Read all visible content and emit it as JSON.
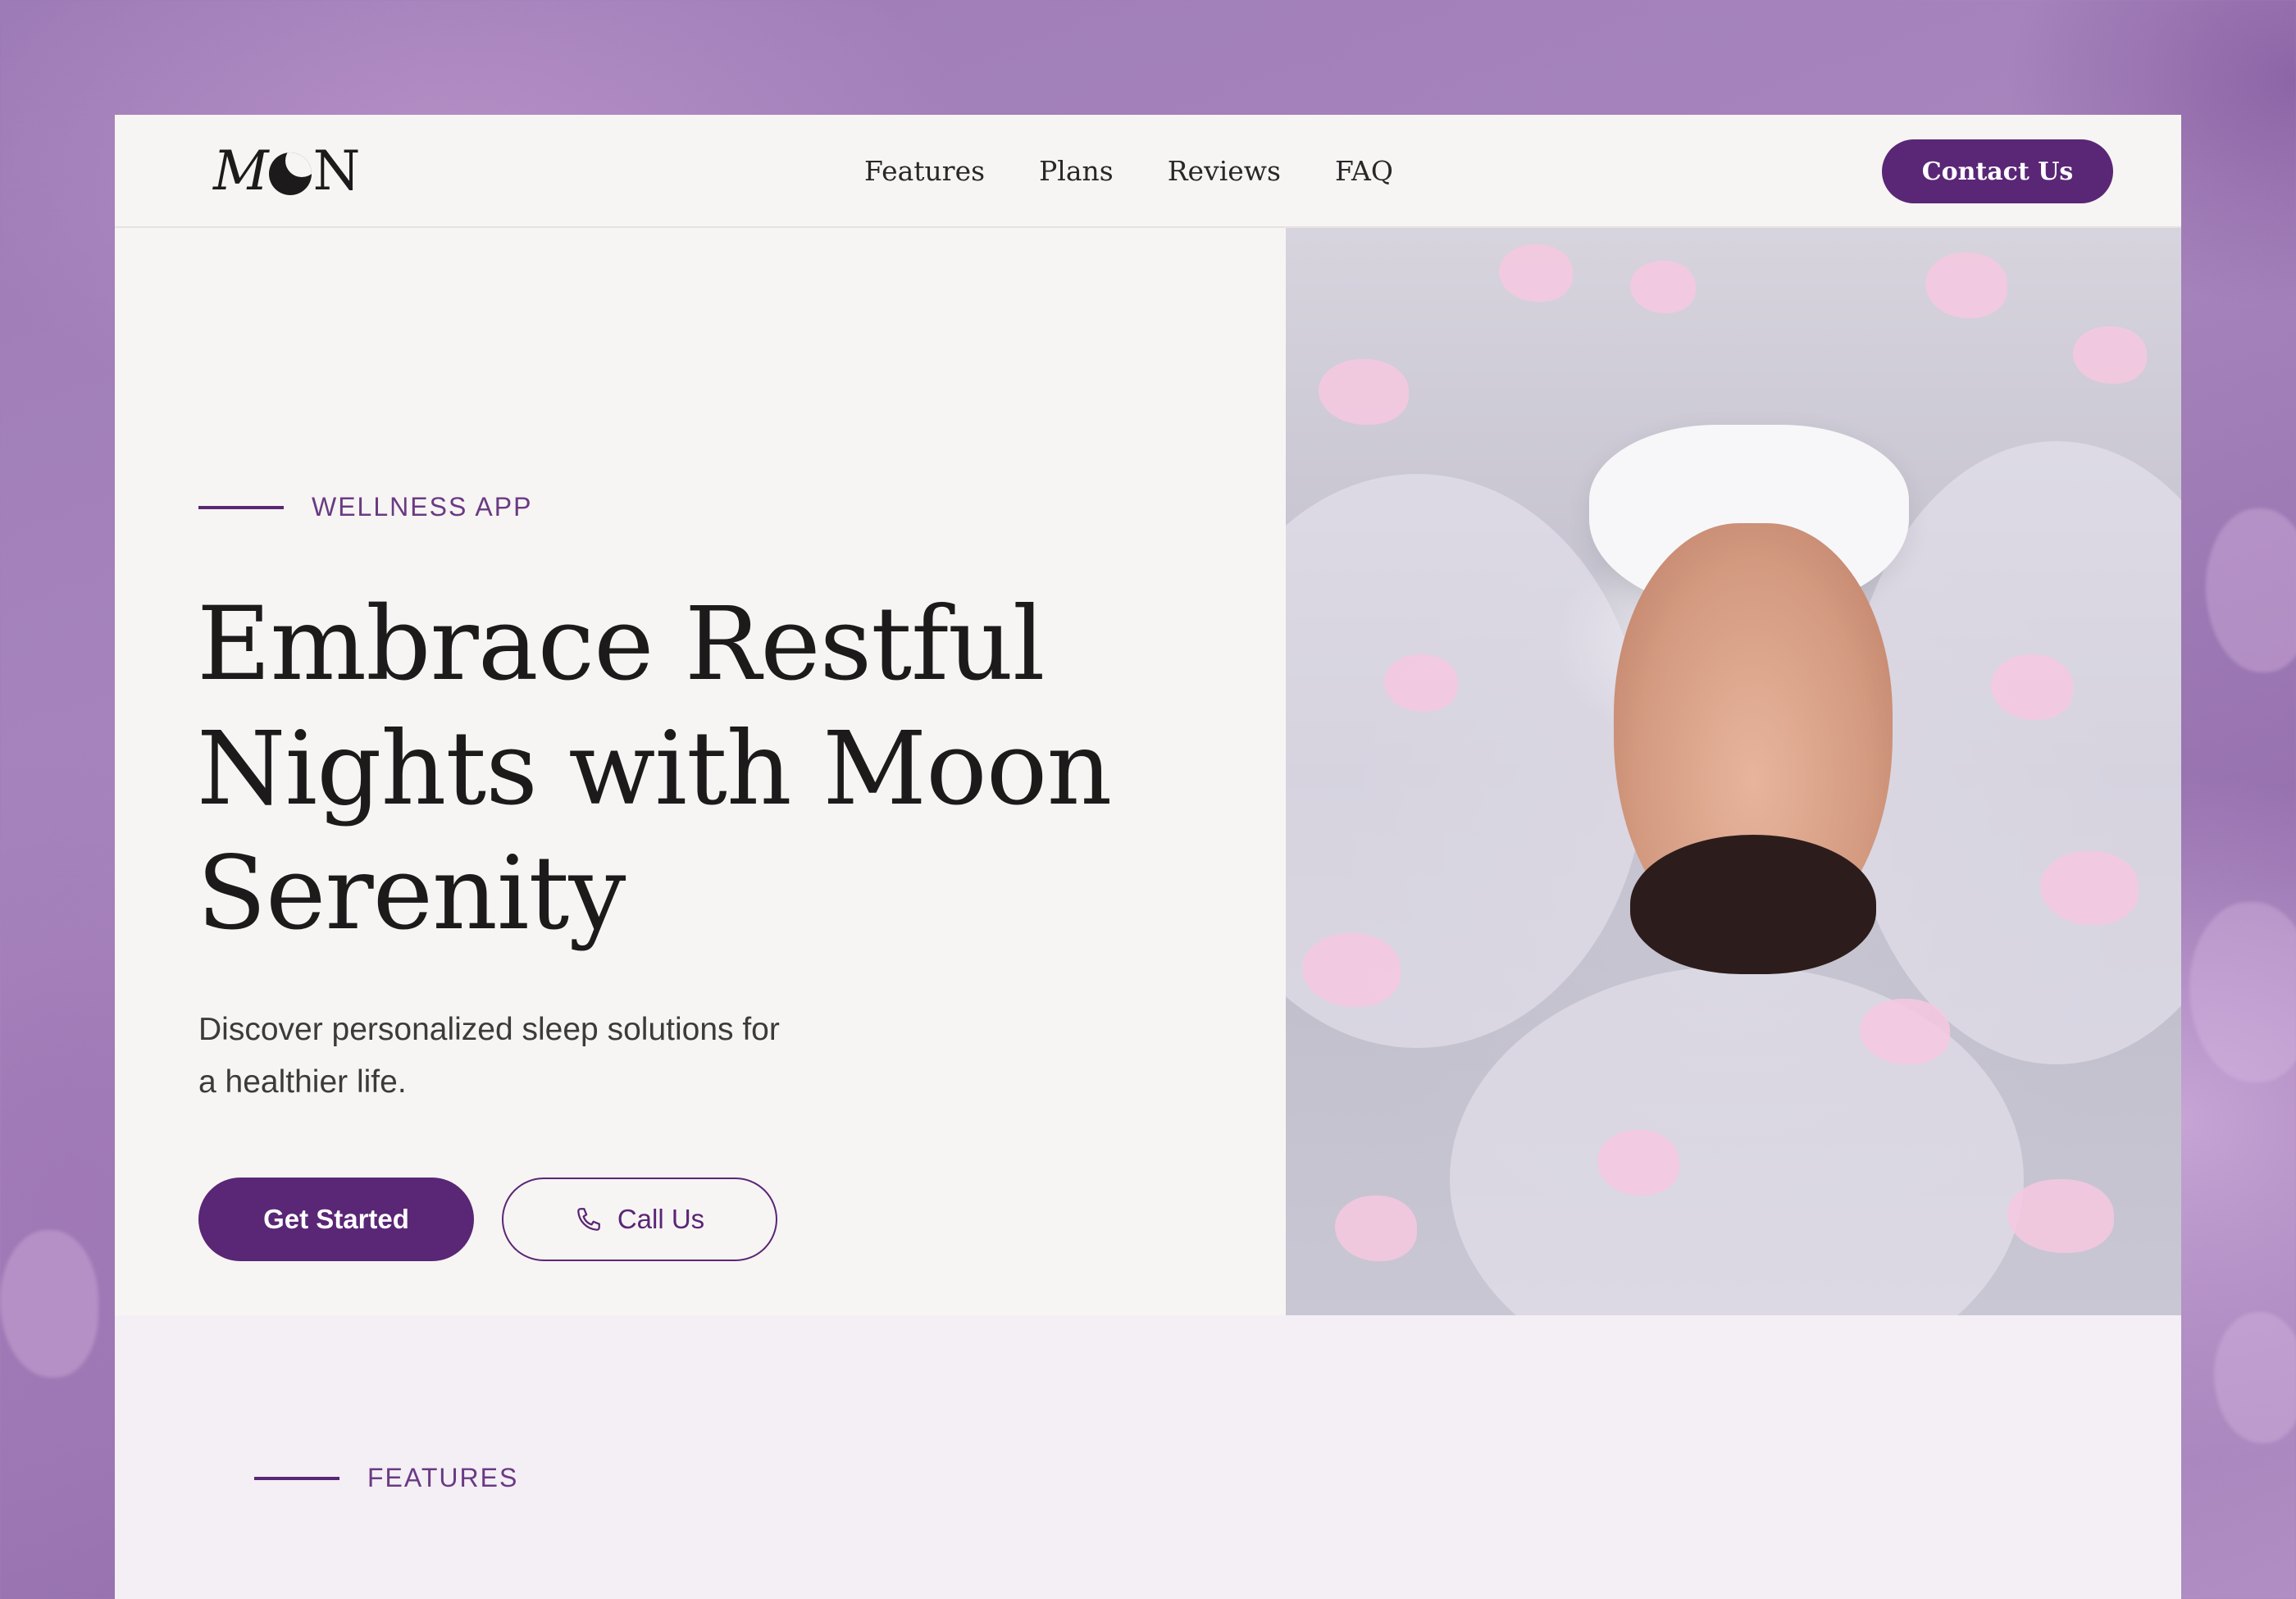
{
  "brand": {
    "logo_text": "MON"
  },
  "nav": {
    "links": [
      "Features",
      "Plans",
      "Reviews",
      "FAQ"
    ],
    "contact_label": "Contact Us"
  },
  "hero": {
    "eyebrow": "WELLNESS APP",
    "headline": "Embrace Restful Nights with Moon Serenity",
    "subtext": "Discover personalized sleep solutions for a healthier life.",
    "primary_cta": "Get Started",
    "secondary_cta": "Call Us",
    "secondary_icon": "phone-icon",
    "image_alt": "woman-resting-in-tulle-and-petals"
  },
  "features": {
    "eyebrow": "FEATURES"
  },
  "colors": {
    "accent": "#5a2676",
    "page_bg": "#f7f5f3",
    "features_bg": "#f4eff5",
    "backdrop": "#a080b8"
  }
}
